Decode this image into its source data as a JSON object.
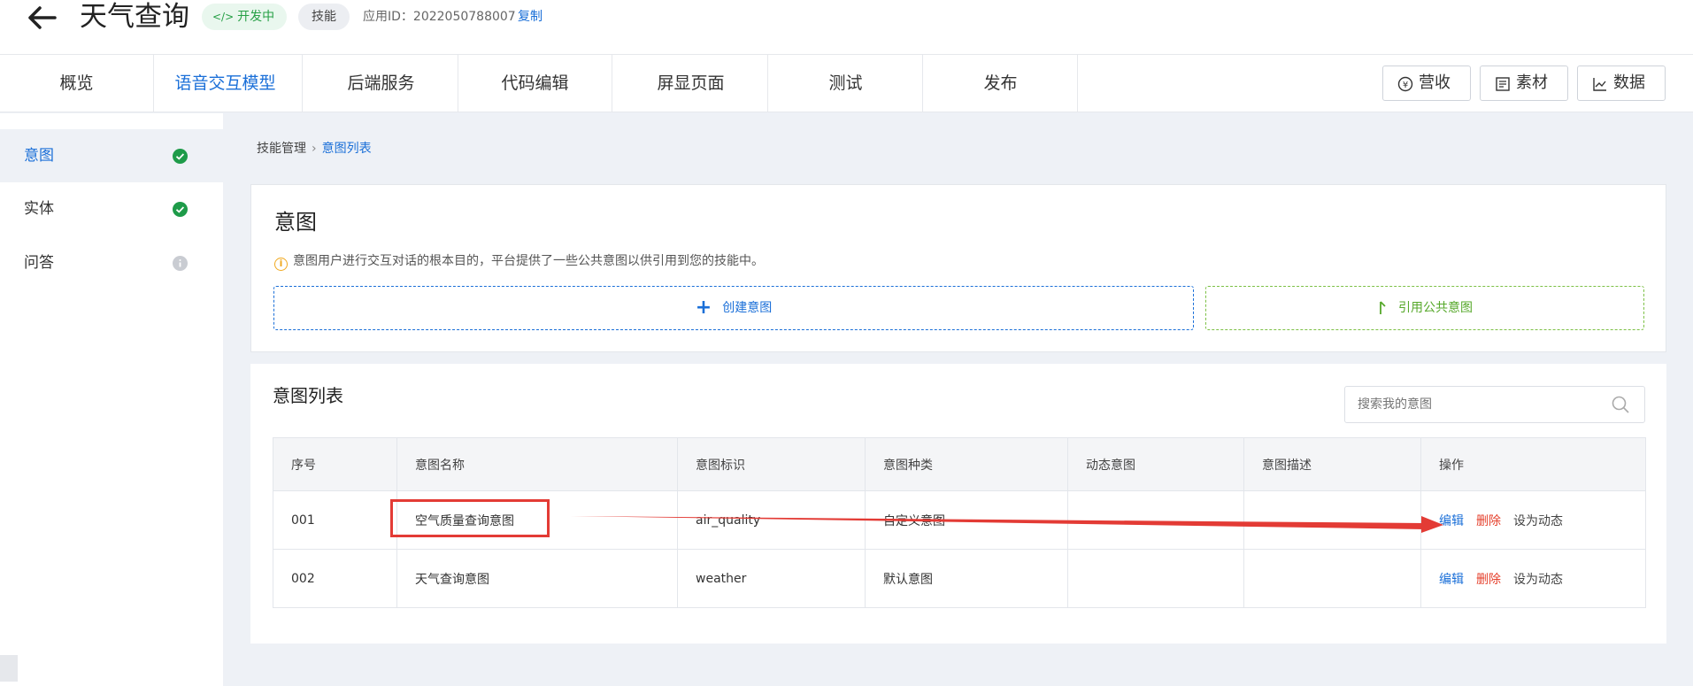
{
  "header": {
    "title": "天气查询",
    "status_badge": "开发中",
    "type_badge": "技能",
    "app_id_label": "应用ID：2022050788007",
    "copy_label": "复制"
  },
  "tabs": [
    {
      "label": "概览",
      "active": false
    },
    {
      "label": "语音交互模型",
      "active": true
    },
    {
      "label": "后端服务",
      "active": false
    },
    {
      "label": "代码编辑",
      "active": false
    },
    {
      "label": "屏显页面",
      "active": false
    },
    {
      "label": "测试",
      "active": false
    },
    {
      "label": "发布",
      "active": false
    }
  ],
  "toolbar": {
    "revenue_label": "营收",
    "material_label": "素材",
    "data_label": "数据"
  },
  "sidebar": {
    "items": [
      {
        "label": "意图",
        "status": "complete",
        "active": true
      },
      {
        "label": "实体",
        "status": "complete",
        "active": false
      },
      {
        "label": "问答",
        "status": "info",
        "active": false
      }
    ]
  },
  "breadcrumb": {
    "parent": "技能管理",
    "current": "意图列表"
  },
  "intent_card": {
    "title": "意图",
    "description": "意图用户进行交互对话的根本目的，平台提供了一些公共意图以供引用到您的技能中。",
    "create_label": "创建意图",
    "reference_label": "引用公共意图"
  },
  "intent_list": {
    "title": "意图列表",
    "search_placeholder": "搜索我的意图",
    "columns": [
      "序号",
      "意图名称",
      "意图标识",
      "意图种类",
      "动态意图",
      "意图描述",
      "操作"
    ],
    "rows": [
      {
        "index": "001",
        "name": "空气质量查询意图",
        "id": "air_quality",
        "kind": "自定义意图",
        "dynamic": "",
        "desc": ""
      },
      {
        "index": "002",
        "name": "天气查询意图",
        "id": "weather",
        "kind": "默认意图",
        "dynamic": "",
        "desc": ""
      }
    ],
    "actions": {
      "edit": "编辑",
      "delete": "删除",
      "set_dynamic": "设为动态"
    }
  },
  "colors": {
    "accent": "#1a6fd8",
    "success": "#1e9b49",
    "danger": "#e5402c",
    "annotation": "#e33b35"
  }
}
